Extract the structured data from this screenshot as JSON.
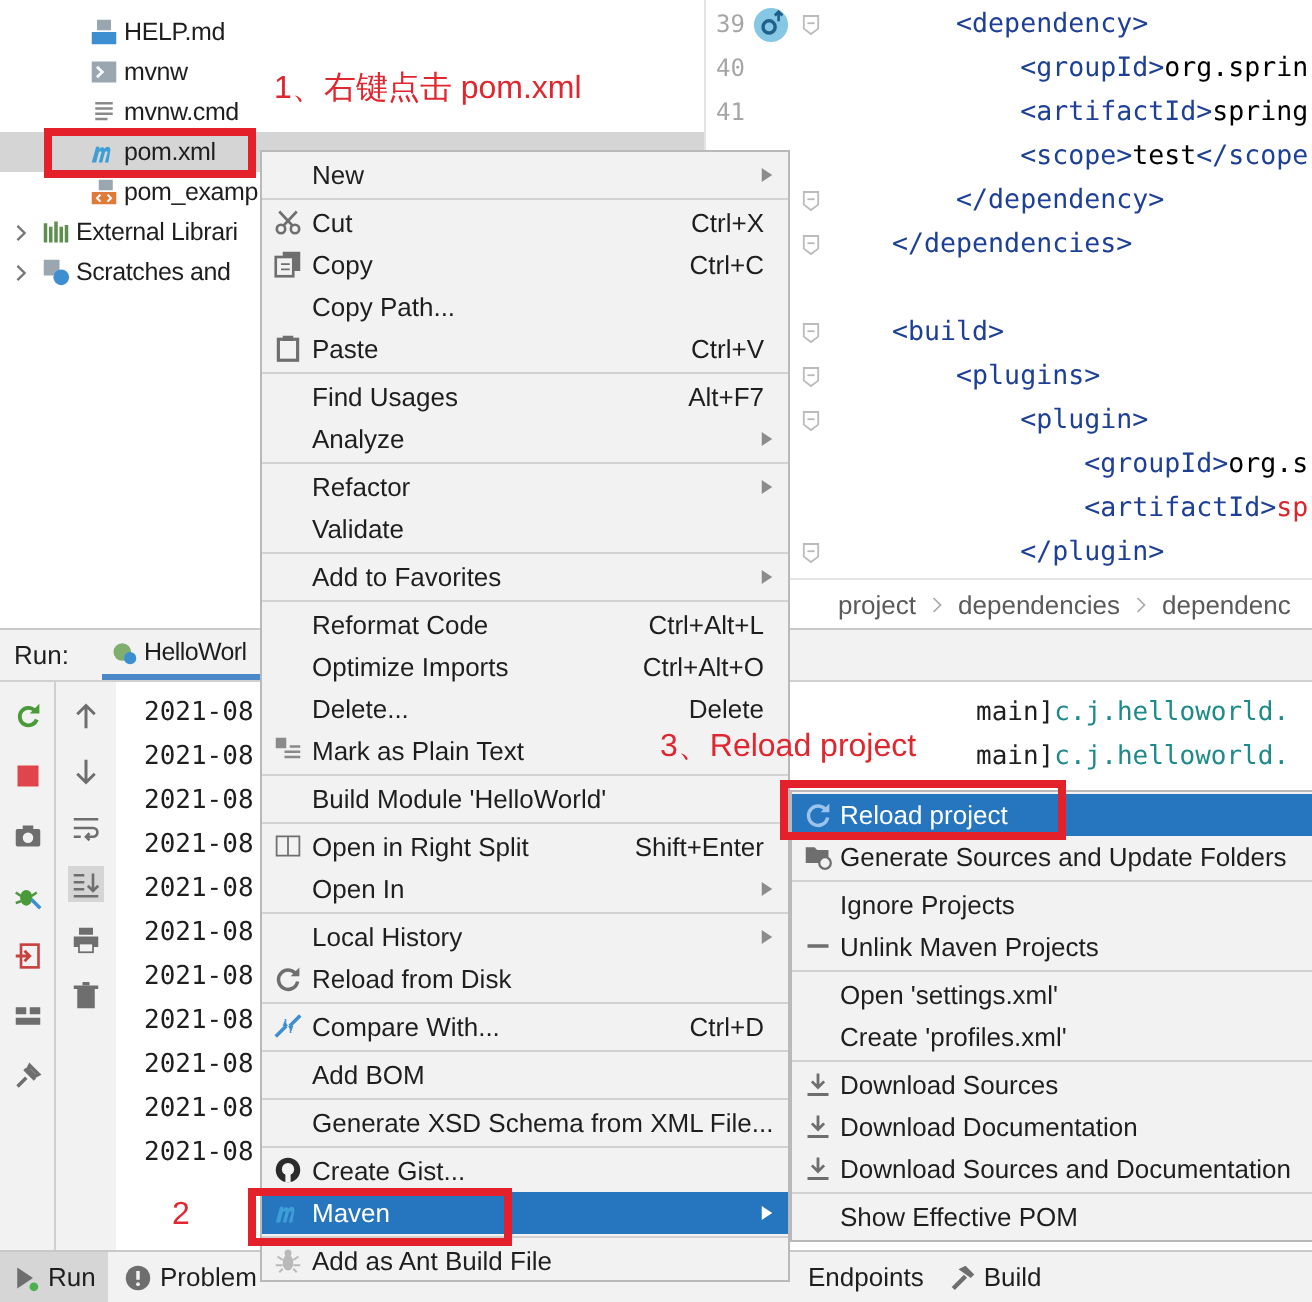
{
  "project_tree": [
    {
      "children": [
        {
          "label": "HELP.md",
          "selected": false
        },
        {
          "label": "mvnw",
          "selected": false
        },
        {
          "label": "mvnw.cmd",
          "selected": false
        },
        {
          "label": "pom.xml",
          "selected": true
        },
        {
          "label": "pom_examp",
          "selected": false
        }
      ]
    },
    {
      "label": "External Librari",
      "expanded": false,
      "selected": false
    },
    {
      "label": "Scratches and",
      "expanded": false,
      "selected": false
    }
  ],
  "editor": {
    "lines": [
      {
        "number": "39",
        "fold": true,
        "parts": [
          {
            "text": "        <dependency>",
            "kind": "tag"
          }
        ]
      },
      {
        "number": "40",
        "fold": false,
        "parts": [
          {
            "text": "            <groupId>",
            "kind": "tag"
          },
          {
            "text": "org.sprin",
            "kind": "text"
          }
        ]
      },
      {
        "number": "41",
        "fold": false,
        "parts": [
          {
            "text": "            <artifactId>",
            "kind": "tag"
          },
          {
            "text": "spring",
            "kind": "text"
          }
        ]
      },
      {
        "fold": false,
        "parts": [
          {
            "text": "            <scope>",
            "kind": "tag"
          },
          {
            "text": "test",
            "kind": "text"
          },
          {
            "text": "</scope",
            "kind": "tag"
          }
        ]
      },
      {
        "fold": true,
        "parts": [
          {
            "text": "        </dependency>",
            "kind": "tag"
          }
        ]
      },
      {
        "fold": true,
        "parts": [
          {
            "text": "    </dependencies>",
            "kind": "tag"
          }
        ]
      },
      {
        "fold": false
      },
      {
        "fold": true,
        "parts": [
          {
            "text": "    <build>",
            "kind": "tag"
          }
        ]
      },
      {
        "fold": true,
        "parts": [
          {
            "text": "        <plugins>",
            "kind": "tag"
          }
        ]
      },
      {
        "fold": true,
        "parts": [
          {
            "text": "            <plugin>",
            "kind": "tag"
          }
        ]
      },
      {
        "fold": false,
        "parts": [
          {
            "text": "                <groupId>",
            "kind": "tag"
          },
          {
            "text": "org.s",
            "kind": "text"
          }
        ]
      },
      {
        "fold": false,
        "parts": [
          {
            "text": "                <artifactId>",
            "kind": "tag"
          },
          {
            "text": "sp",
            "kind": "error"
          }
        ]
      },
      {
        "fold": true,
        "parts": [
          {
            "text": "            </plugin>",
            "kind": "tag"
          }
        ]
      }
    ],
    "breadcrumb": [
      "project",
      "dependencies",
      "dependenc"
    ]
  },
  "run_panel": {
    "label": "Run:",
    "tab": "HelloWorl",
    "scroll_to_end": {
      "selected": true
    },
    "console": [
      {
        "time": "2021-08",
        "thread": "main]",
        "logger": "c.j.helloworld."
      },
      {
        "time": "2021-08",
        "thread": "main]",
        "logger": "c.j.helloworld."
      },
      {
        "time": "2021-08"
      },
      {
        "time": "2021-08"
      },
      {
        "time": "2021-08"
      },
      {
        "time": "2021-08"
      },
      {
        "time": "2021-08"
      },
      {
        "time": "2021-08"
      },
      {
        "time": "2021-08"
      },
      {
        "time": "2021-08"
      },
      {
        "time": "2021-08"
      }
    ]
  },
  "context_menu": {
    "sections": [
      [
        {
          "label": "New",
          "submenu": true,
          "selected": false
        }
      ],
      [
        {
          "label": "Cut",
          "shortcut": "Ctrl+X",
          "selected": false
        },
        {
          "label": "Copy",
          "shortcut": "Ctrl+C",
          "selected": false
        },
        {
          "label": "Copy Path...",
          "selected": false
        },
        {
          "label": "Paste",
          "shortcut": "Ctrl+V",
          "selected": false
        }
      ],
      [
        {
          "label": "Find Usages",
          "shortcut": "Alt+F7",
          "selected": false
        },
        {
          "label": "Analyze",
          "submenu": true,
          "selected": false
        }
      ],
      [
        {
          "label": "Refactor",
          "submenu": true,
          "selected": false
        },
        {
          "label": "Validate",
          "selected": false
        }
      ],
      [
        {
          "label": "Add to Favorites",
          "submenu": true,
          "selected": false
        }
      ],
      [
        {
          "label": "Reformat Code",
          "shortcut": "Ctrl+Alt+L",
          "selected": false
        },
        {
          "label": "Optimize Imports",
          "shortcut": "Ctrl+Alt+O",
          "selected": false
        },
        {
          "label": "Delete...",
          "shortcut": "Delete",
          "selected": false
        },
        {
          "label": "Mark as Plain Text",
          "selected": false
        }
      ],
      [
        {
          "label": "Build Module 'HelloWorld'",
          "selected": false
        }
      ],
      [
        {
          "label": "Open in Right Split",
          "shortcut": "Shift+Enter",
          "selected": false
        },
        {
          "label": "Open In",
          "submenu": true,
          "selected": false
        }
      ],
      [
        {
          "label": "Local History",
          "submenu": true,
          "selected": false
        },
        {
          "label": "Reload from Disk",
          "selected": false
        }
      ],
      [
        {
          "label": "Compare With...",
          "shortcut": "Ctrl+D",
          "selected": false
        }
      ],
      [
        {
          "label": "Add BOM",
          "selected": false
        }
      ],
      [
        {
          "label": "Generate XSD Schema from XML File...",
          "selected": false
        }
      ],
      [
        {
          "label": "Create Gist...",
          "selected": false
        },
        {
          "label": "Maven",
          "submenu": true,
          "selected": true
        }
      ],
      [
        {
          "label": "Add as Ant Build File",
          "selected": false
        }
      ]
    ]
  },
  "submenu": {
    "sections": [
      [
        {
          "label": "Reload project",
          "selected": true
        },
        {
          "label": "Generate Sources and Update Folders",
          "selected": false
        }
      ],
      [
        {
          "label": "Ignore Projects",
          "selected": false
        },
        {
          "label": "Unlink Maven Projects",
          "selected": false
        }
      ],
      [
        {
          "label": "Open 'settings.xml'",
          "selected": false
        },
        {
          "label": "Create 'profiles.xml'",
          "selected": false
        }
      ],
      [
        {
          "label": "Download Sources",
          "selected": false
        },
        {
          "label": "Download Documentation",
          "selected": false
        },
        {
          "label": "Download Sources and Documentation",
          "selected": false
        }
      ],
      [
        {
          "label": "Show Effective POM",
          "selected": false
        }
      ]
    ]
  },
  "bottom_bar": [
    {
      "label": "Run",
      "selected": true
    },
    {
      "label": "Problem",
      "selected": false
    },
    {
      "label": "Endpoints",
      "selected": false
    },
    {
      "label": "Build",
      "selected": false
    }
  ],
  "annotations": [
    "1、右键点击 pom.xml",
    "2",
    "3、Reload project"
  ]
}
